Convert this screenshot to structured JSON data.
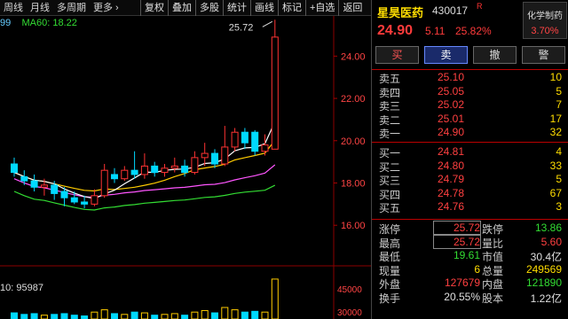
{
  "toolbar": {
    "items": [
      "周线",
      "月线",
      "多周期",
      "更多 ›"
    ],
    "buttons": [
      "复权",
      "叠加",
      "多股",
      "统计",
      "画线",
      "标记",
      "+自选",
      "返回"
    ]
  },
  "legend": {
    "ma1_text": "99",
    "ma60_text": "MA60: 18.22"
  },
  "chart": {
    "high_label": "25.72",
    "y_ticks": [
      "24.00",
      "22.00",
      "20.00",
      "18.00",
      "16.00"
    ],
    "y_tick_values": [
      24,
      22,
      20,
      18,
      16
    ],
    "ylim": [
      14.5,
      25.9
    ],
    "vol_label": "10: 95987",
    "vol_ticks": [
      "45000",
      "30000"
    ],
    "colors": {
      "up": "#ff3333",
      "down": "#00d9ff",
      "ma5": "#ffffff",
      "ma10": "#ffcc00",
      "ma20": "#ff55ff",
      "ma60": "#33dd33"
    }
  },
  "chart_data": {
    "type": "candlestick",
    "title": "",
    "candles": [
      {
        "o": 18.9,
        "c": 18.5,
        "h": 19.2,
        "l": 18.3
      },
      {
        "o": 18.3,
        "c": 18.1,
        "h": 18.6,
        "l": 17.9
      },
      {
        "o": 18.1,
        "c": 17.8,
        "h": 18.4,
        "l": 17.6
      },
      {
        "o": 17.8,
        "c": 17.9,
        "h": 18.2,
        "l": 17.4
      },
      {
        "o": 17.9,
        "c": 17.5,
        "h": 18.1,
        "l": 17.2
      },
      {
        "o": 17.6,
        "c": 17.3,
        "h": 17.8,
        "l": 16.9
      },
      {
        "o": 17.3,
        "c": 17.1,
        "h": 17.6,
        "l": 17.0
      },
      {
        "o": 17.1,
        "c": 17.0,
        "h": 17.4,
        "l": 16.8
      },
      {
        "o": 17.0,
        "c": 17.4,
        "h": 17.7,
        "l": 16.9
      },
      {
        "o": 17.4,
        "c": 18.6,
        "h": 18.9,
        "l": 17.3
      },
      {
        "o": 18.4,
        "c": 18.2,
        "h": 18.7,
        "l": 18.0
      },
      {
        "o": 18.2,
        "c": 18.6,
        "h": 18.8,
        "l": 18.1
      },
      {
        "o": 18.6,
        "c": 18.4,
        "h": 19.5,
        "l": 18.2
      },
      {
        "o": 18.4,
        "c": 18.8,
        "h": 19.4,
        "l": 18.2
      },
      {
        "o": 18.8,
        "c": 18.5,
        "h": 19.0,
        "l": 18.3
      },
      {
        "o": 18.5,
        "c": 18.7,
        "h": 18.9,
        "l": 18.3
      },
      {
        "o": 18.7,
        "c": 18.8,
        "h": 19.2,
        "l": 18.5
      },
      {
        "o": 18.8,
        "c": 18.5,
        "h": 19.1,
        "l": 18.3
      },
      {
        "o": 18.5,
        "c": 19.2,
        "h": 19.5,
        "l": 18.4
      },
      {
        "o": 19.2,
        "c": 19.4,
        "h": 19.9,
        "l": 18.8
      },
      {
        "o": 19.4,
        "c": 18.9,
        "h": 19.6,
        "l": 18.7
      },
      {
        "o": 18.9,
        "c": 19.7,
        "h": 20.7,
        "l": 18.8
      },
      {
        "o": 19.7,
        "c": 20.4,
        "h": 20.6,
        "l": 19.5
      },
      {
        "o": 20.4,
        "c": 19.9,
        "h": 20.6,
        "l": 19.6
      },
      {
        "o": 20.4,
        "c": 19.5,
        "h": 20.5,
        "l": 19.3
      },
      {
        "o": 19.5,
        "c": 19.8,
        "h": 20.3,
        "l": 19.3
      },
      {
        "o": 19.6,
        "c": 24.9,
        "h": 25.72,
        "l": 19.6
      }
    ],
    "volumes": [
      8000,
      6000,
      7000,
      5000,
      6000,
      7000,
      5000,
      4000,
      9000,
      12000,
      7000,
      6000,
      9000,
      8000,
      5000,
      6000,
      7000,
      5000,
      9000,
      11000,
      8000,
      15000,
      12000,
      9000,
      10000,
      9000,
      52000
    ]
  },
  "stock": {
    "name": "星昊医药",
    "code": "430017",
    "flag": "R",
    "price": "24.90",
    "change": "5.11",
    "pct": "25.82%",
    "sector_name": "化学制药",
    "sector_pct": "3.70%"
  },
  "trade_buttons": [
    "买",
    "卖",
    "撤",
    "警"
  ],
  "asks": [
    {
      "label": "卖五",
      "price": "25.10",
      "vol": "10"
    },
    {
      "label": "卖四",
      "price": "25.05",
      "vol": "5"
    },
    {
      "label": "卖三",
      "price": "25.02",
      "vol": "7"
    },
    {
      "label": "卖二",
      "price": "25.01",
      "vol": "17"
    },
    {
      "label": "卖一",
      "price": "24.90",
      "vol": "32"
    }
  ],
  "bids": [
    {
      "label": "买一",
      "price": "24.81",
      "vol": "4"
    },
    {
      "label": "买二",
      "price": "24.80",
      "vol": "33"
    },
    {
      "label": "买三",
      "price": "24.79",
      "vol": "5"
    },
    {
      "label": "买四",
      "price": "24.78",
      "vol": "67"
    },
    {
      "label": "买五",
      "price": "24.76",
      "vol": "3"
    }
  ],
  "stats": [
    {
      "l1": "涨停",
      "v1": "25.72",
      "c1": "red",
      "l2": "跌停",
      "v2": "13.86",
      "c2": "grn"
    },
    {
      "l1": "最高",
      "v1": "25.72",
      "c1": "red",
      "l2": "量比",
      "v2": "5.60",
      "c2": "red"
    },
    {
      "l1": "最低",
      "v1": "19.61",
      "c1": "grn",
      "l2": "市值",
      "v2": "30.4亿",
      "c2": "wht"
    },
    {
      "l1": "现量",
      "v1": "6",
      "c1": "yel",
      "l2": "总量",
      "v2": "249569",
      "c2": "yel"
    },
    {
      "l1": "外盘",
      "v1": "127679",
      "c1": "red",
      "l2": "内盘",
      "v2": "121890",
      "c2": "grn"
    },
    {
      "l1": "换手",
      "v1": "20.55%",
      "c1": "wht",
      "l2": "股本",
      "v2": "1.22亿",
      "c2": "wht"
    }
  ]
}
